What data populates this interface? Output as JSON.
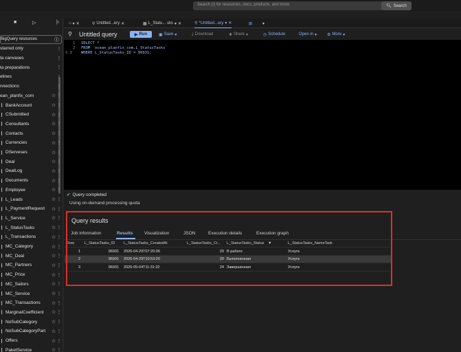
{
  "topbar": {
    "search_placeholder": "Search (/) for resources, docs, products, and more",
    "search_button": "Search"
  },
  "sidebar": {
    "add_label": "BigQuery resources",
    "items": [
      {
        "label": "starred only",
        "star": false
      },
      {
        "label": "ta canvases",
        "star": false
      },
      {
        "label": "ta preparations",
        "star": false
      },
      {
        "label": "elines",
        "star": false
      },
      {
        "label": "nnections",
        "star": false
      },
      {
        "label": "ean_planfix_com",
        "star": true
      },
      {
        "label": "BankAccount",
        "star": true
      },
      {
        "label": "CSubmitted",
        "star": true
      },
      {
        "label": "Consultants",
        "star": true
      },
      {
        "label": "Contacts",
        "star": true
      },
      {
        "label": "Currencies",
        "star": true
      },
      {
        "label": "DServeses",
        "star": true
      },
      {
        "label": "Deal",
        "star": true
      },
      {
        "label": "DealLog",
        "star": true
      },
      {
        "label": "Documents",
        "star": true
      },
      {
        "label": "Employee",
        "star": true
      },
      {
        "label": "L_Leads",
        "star": true
      },
      {
        "label": "L_PaymentRequest",
        "star": true
      },
      {
        "label": "L_Service",
        "star": true
      },
      {
        "label": "L_StatusTasks",
        "star": true
      },
      {
        "label": "L_Transactions",
        "star": true
      },
      {
        "label": "MC_Category",
        "star": true
      },
      {
        "label": "MC_Deal",
        "star": true
      },
      {
        "label": "MC_Partners",
        "star": true
      },
      {
        "label": "MC_Price",
        "star": true
      },
      {
        "label": "MC_Sailors",
        "star": true
      },
      {
        "label": "MC_Service",
        "star": true
      },
      {
        "label": "MC_Transactions",
        "star": true
      },
      {
        "label": "MarginalCoefficient",
        "star": true
      },
      {
        "label": "NoSubCategory",
        "star": true
      },
      {
        "label": "NoSubCategoryPart",
        "star": true
      },
      {
        "label": "Offers",
        "star": true
      },
      {
        "label": "PaketService",
        "star": true
      }
    ]
  },
  "tabs": [
    {
      "label": "Untitled...ery"
    },
    {
      "label": "L_Statu... sks"
    },
    {
      "label": "*Untitled...ery"
    }
  ],
  "query": {
    "title": "Untitled query",
    "run": "Run",
    "save": "Save",
    "download": "Download",
    "share": "Share",
    "schedule": "Schedule",
    "open_in": "Open in",
    "more": "More",
    "lines": [
      "SELECT *",
      "FROM `ocean_planfix_com.L_StatusTasks`",
      "WHERE L_StatusTasks_ID = 96931;"
    ]
  },
  "status": {
    "completed": "Query completed",
    "note": "Using on-demand processing quota"
  },
  "results": {
    "title": "Query results",
    "tabs": [
      "Job information",
      "Results",
      "Visualization",
      "JSON",
      "Execution details",
      "Execution graph"
    ],
    "columns": [
      "Row",
      "L_StatusTasks_ID",
      "L_StatusTasks_CreatedAt",
      "L_StatusTasks_Cr...",
      "L_StatusTasks_Status",
      "L_StatusTasks_NameTask"
    ],
    "rows": [
      [
        "1",
        "96931",
        "2026-04-29T07:20:06",
        "20",
        "В работе",
        "Услуга"
      ],
      [
        "2",
        "96931",
        "2026-04-29T10:53:20",
        "20",
        "Выполненная",
        "Услуга"
      ],
      [
        "3",
        "96931",
        "2026-05-04T11:31:32",
        "24",
        "Завершенная",
        "Услуга"
      ]
    ]
  },
  "colors": {
    "accent": "#8ab4f8",
    "highlight_box": "#e0302a",
    "success": "#81c995"
  }
}
